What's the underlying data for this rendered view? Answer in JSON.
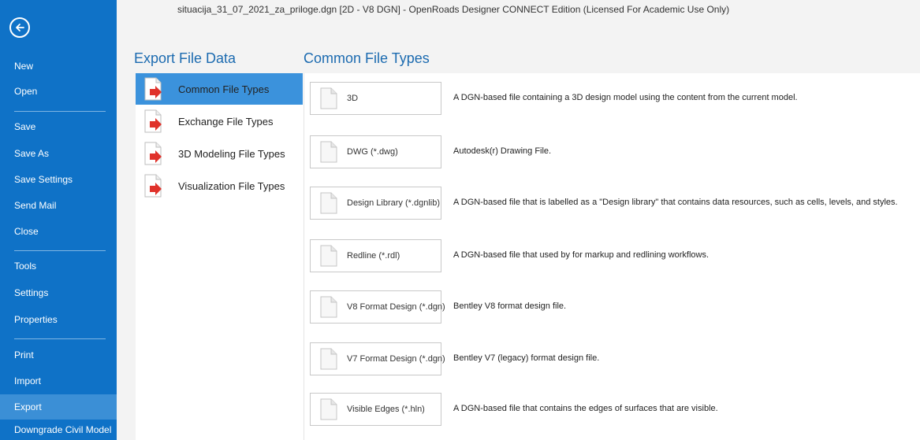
{
  "window": {
    "title": "situacija_31_07_2021_za_priloge.dgn [2D - V8 DGN] - OpenRoads Designer CONNECT Edition (Licensed For Academic Use Only)"
  },
  "backstage": {
    "back_icon": "arrow-left-circle-icon",
    "items": [
      {
        "label": "New"
      },
      {
        "label": "Open"
      },
      {
        "label": "Save"
      },
      {
        "label": "Save As"
      },
      {
        "label": "Save Settings"
      },
      {
        "label": "Send Mail"
      },
      {
        "label": "Close"
      },
      {
        "label": "Tools"
      },
      {
        "label": "Settings"
      },
      {
        "label": "Properties"
      },
      {
        "label": "Print"
      },
      {
        "label": "Import"
      },
      {
        "label": "Export"
      },
      {
        "label": "Downgrade Civil Model"
      }
    ],
    "active_item": "Export",
    "colors": {
      "nav_bg": "#0f72c7",
      "nav_active": "#3b8fd6",
      "heading": "#1c6bb0",
      "selected_category": "#3b92dc"
    }
  },
  "export": {
    "heading": "Export File Data",
    "categories": [
      {
        "label": "Common File Types",
        "icon": "export-file-icon"
      },
      {
        "label": "Exchange File Types",
        "icon": "export-file-icon"
      },
      {
        "label": "3D Modeling File Types",
        "icon": "export-file-icon"
      },
      {
        "label": "Visualization File Types",
        "icon": "export-file-icon"
      }
    ],
    "selected_category": "Common File Types"
  },
  "file_types": {
    "heading": "Common File Types",
    "items": [
      {
        "name": "3D",
        "description": "A DGN-based file containing a 3D design model using the content from the current model."
      },
      {
        "name": "DWG (*.dwg)",
        "description": "Autodesk(r) Drawing File."
      },
      {
        "name": "Design Library (*.dgnlib)",
        "description": "A DGN-based file that is labelled as a \"Design library\" that contains data resources, such as cells, levels, and styles."
      },
      {
        "name": "Redline (*.rdl)",
        "description": "A DGN-based file that used by for markup and redlining workflows."
      },
      {
        "name": "V8 Format Design (*.dgn)",
        "description": "Bentley V8 format design file."
      },
      {
        "name": "V7 Format Design (*.dgn)",
        "description": "Bentley V7 (legacy) format design file."
      },
      {
        "name": "Visible Edges (*.hln)",
        "description": "A DGN-based file that contains the edges of surfaces that are visible."
      }
    ]
  }
}
